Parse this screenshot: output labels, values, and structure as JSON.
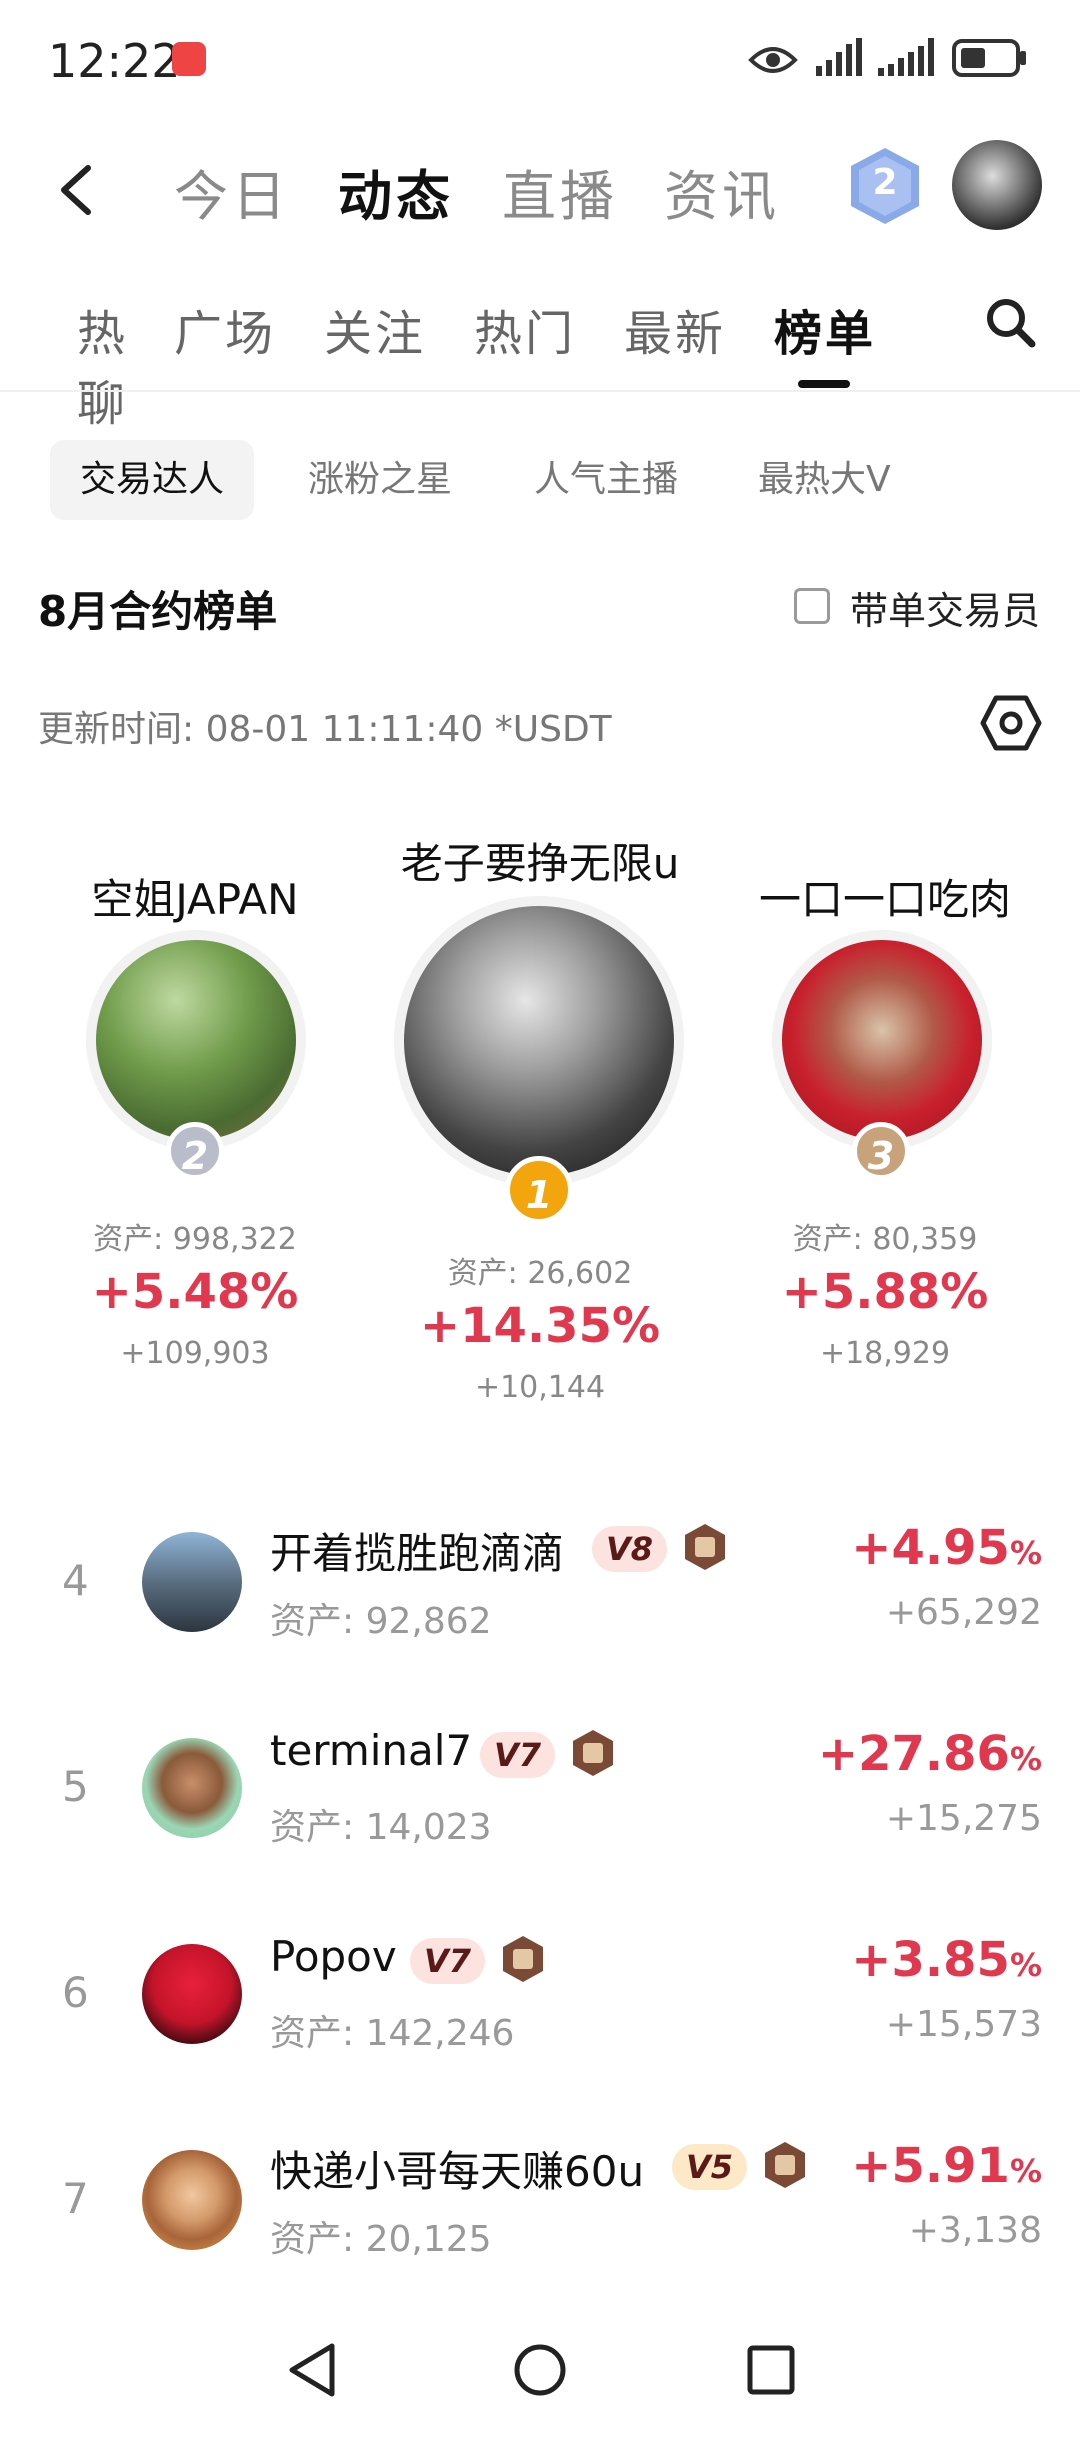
{
  "status_bar": {
    "time": "12:22"
  },
  "header": {
    "tabs": [
      "今日",
      "动态",
      "直播",
      "资讯"
    ],
    "active_tab": "动态",
    "level_badge": "2"
  },
  "subnav": {
    "tabs": [
      "热聊",
      "广场",
      "关注",
      "热门",
      "最新",
      "榜单"
    ],
    "active_tab": "榜单"
  },
  "chips": [
    "交易达人",
    "涨粉之星",
    "人气主播",
    "最热大V"
  ],
  "board": {
    "title": "8月合约榜单",
    "checkbox_label": "带单交易员",
    "update_time": "更新时间:  08-01 11:11:40  *USDT"
  },
  "podium": [
    {
      "rank": "2",
      "name": "空姐JAPAN",
      "asset": "资产: 998,322",
      "pct": "+5.48%",
      "pnl": "+109,903"
    },
    {
      "rank": "1",
      "name": "老子要挣无限u",
      "asset": "资产: 26,602",
      "pct": "+14.35%",
      "pnl": "+10,144"
    },
    {
      "rank": "3",
      "name": "一口一口吃肉",
      "asset": "资产: 80,359",
      "pct": "+5.88%",
      "pnl": "+18,929"
    }
  ],
  "list": [
    {
      "rank": "4",
      "name": "开着揽胜跑滴滴",
      "vip": "V8",
      "asset": "资产: 92,862",
      "pct": "+4.95",
      "pnl": "+65,292"
    },
    {
      "rank": "5",
      "name": "terminal7",
      "vip": "V7",
      "asset": "资产: 14,023",
      "pct": "+27.86",
      "pnl": "+15,275"
    },
    {
      "rank": "6",
      "name": "Popov",
      "vip": "V7",
      "asset": "资产: 142,246",
      "pct": "+3.85",
      "pnl": "+15,573"
    },
    {
      "rank": "7",
      "name": "快递小哥每天赚60u",
      "vip": "V5",
      "asset": "资产: 20,125",
      "pct": "+5.91",
      "pnl": "+3,138"
    }
  ],
  "pct_unit": "%",
  "colors": {
    "gain": "#e0394f",
    "muted": "#999999",
    "gold": "#f2a50c",
    "silver": "#b8bccb",
    "bronze": "#c8a27a"
  }
}
